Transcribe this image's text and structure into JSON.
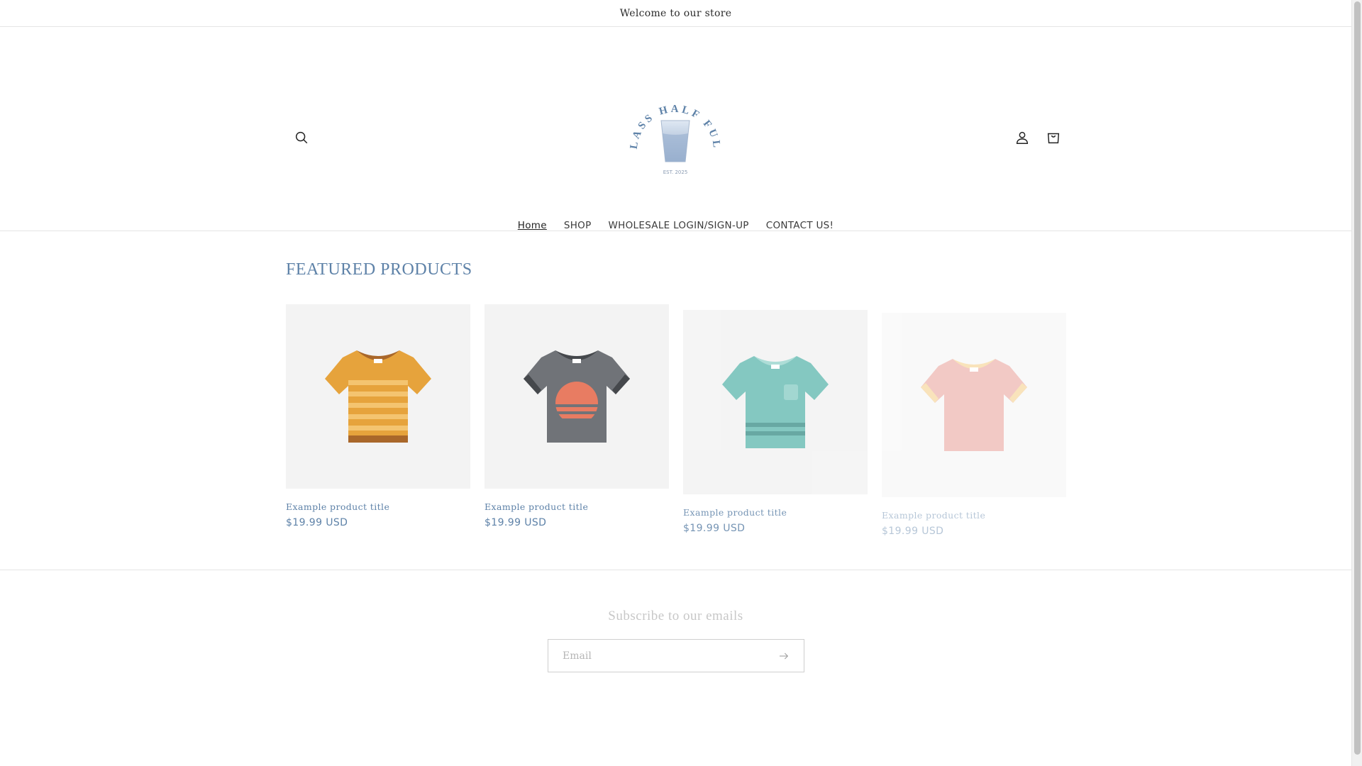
{
  "announcement": {
    "text": "Welcome to our store"
  },
  "header": {
    "logo": {
      "arc_text": "GLASS HALF FULL",
      "est_text": "EST. 2025"
    },
    "icons": {
      "search": "search-icon",
      "account": "user-icon",
      "cart": "cart-icon"
    }
  },
  "nav": {
    "items": [
      {
        "label": "Home",
        "active": true
      },
      {
        "label": "SHOP",
        "active": false
      },
      {
        "label": "WHOLESALE LOGIN/SIGN-UP",
        "active": false
      },
      {
        "label": "CONTACT US!",
        "active": false
      }
    ]
  },
  "featured": {
    "heading": "FEATURED PRODUCTS",
    "products": [
      {
        "title": "Example product title",
        "price": "$19.99 USD",
        "shirt": "orange-striped-tshirt"
      },
      {
        "title": "Example product title",
        "price": "$19.99 USD",
        "shirt": "gray-sunset-tshirt"
      },
      {
        "title": "Example product title",
        "price": "$19.99 USD",
        "shirt": "teal-pocket-tshirt"
      },
      {
        "title": "Example product title",
        "price": "$19.99 USD",
        "shirt": "pink-tshirt"
      }
    ]
  },
  "newsletter": {
    "heading": "Subscribe to our emails",
    "email_placeholder": "Email",
    "submit_icon": "arrow-right-icon"
  },
  "colors": {
    "accent_blue": "#5e82a8",
    "border": "#e5e5e5"
  }
}
